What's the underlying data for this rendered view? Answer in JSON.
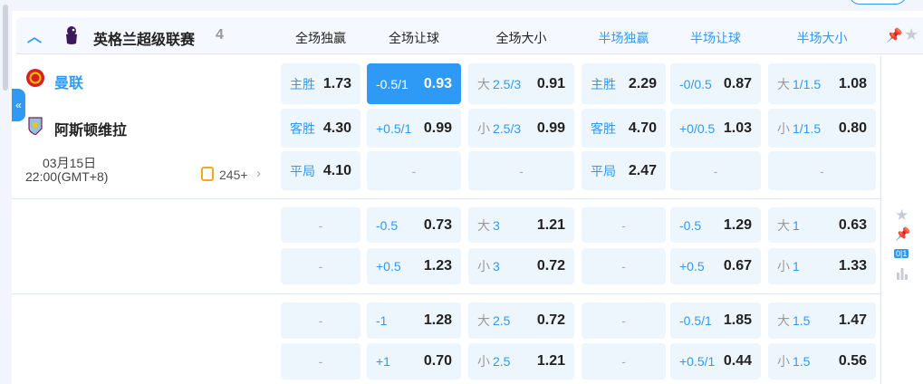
{
  "league": {
    "name": "英格兰超级联赛",
    "count": "4"
  },
  "columns": [
    {
      "label": "全场独赢",
      "half": false
    },
    {
      "label": "全场让球",
      "half": false
    },
    {
      "label": "全场大小",
      "half": false
    },
    {
      "label": "半场独赢",
      "half": true
    },
    {
      "label": "半场让球",
      "half": true
    },
    {
      "label": "半场大小",
      "half": true
    }
  ],
  "match": {
    "home": "曼联",
    "away": "阿斯顿维拉",
    "date": "03月15日",
    "time": "22:00(GMT+8)",
    "more_bets": "245+"
  },
  "colors": {
    "accent": "#2e9af5",
    "cell_bg": "#eef6fd"
  },
  "rows": [
    [
      {
        "pre": "主胜",
        "pb": true,
        "odds": "1.73"
      },
      {
        "line": "-0.5/1",
        "odds": "0.93",
        "active": true
      },
      {
        "pre": "大",
        "line": "2.5/3",
        "odds": "0.91"
      },
      {
        "pre": "主胜",
        "pb": true,
        "odds": "2.29"
      },
      {
        "line": "-0/0.5",
        "odds": "0.87"
      },
      {
        "pre": "大",
        "line": "1/1.5",
        "odds": "1.08"
      }
    ],
    [
      {
        "pre": "客胜",
        "pb": true,
        "odds": "4.30"
      },
      {
        "line": "+0.5/1",
        "odds": "0.99"
      },
      {
        "pre": "小",
        "line": "2.5/3",
        "odds": "0.99"
      },
      {
        "pre": "客胜",
        "pb": true,
        "odds": "4.70"
      },
      {
        "line": "+0/0.5",
        "odds": "1.03"
      },
      {
        "pre": "小",
        "line": "1/1.5",
        "odds": "0.80"
      }
    ],
    [
      {
        "pre": "平局",
        "pb": true,
        "odds": "4.10"
      },
      {
        "dash": "-"
      },
      {
        "dash": "-"
      },
      {
        "pre": "平局",
        "pb": true,
        "odds": "2.47"
      },
      {
        "dash": "-"
      },
      {
        "dash": "-"
      }
    ],
    [
      {
        "dash": "-"
      },
      {
        "line": "-0.5",
        "odds": "0.73"
      },
      {
        "pre": "大",
        "line": "3",
        "odds": "1.21"
      },
      {
        "dash": "-"
      },
      {
        "line": "-0.5",
        "odds": "1.29"
      },
      {
        "pre": "大",
        "line": "1",
        "odds": "0.63"
      }
    ],
    [
      {
        "dash": "-"
      },
      {
        "line": "+0.5",
        "odds": "1.23"
      },
      {
        "pre": "小",
        "line": "3",
        "odds": "0.72"
      },
      {
        "dash": "-"
      },
      {
        "line": "+0.5",
        "odds": "0.67"
      },
      {
        "pre": "小",
        "line": "1",
        "odds": "1.33"
      }
    ],
    [
      {
        "dash": "-"
      },
      {
        "line": "-1",
        "odds": "1.28"
      },
      {
        "pre": "大",
        "line": "2.5",
        "odds": "0.72"
      },
      {
        "dash": "-"
      },
      {
        "line": "-0.5/1",
        "odds": "1.85"
      },
      {
        "pre": "大",
        "line": "1.5",
        "odds": "1.47"
      }
    ],
    [
      {
        "dash": "-"
      },
      {
        "line": "+1",
        "odds": "0.70"
      },
      {
        "pre": "小",
        "line": "2.5",
        "odds": "1.21"
      },
      {
        "dash": "-"
      },
      {
        "line": "+0.5/1",
        "odds": "0.44"
      },
      {
        "pre": "小",
        "line": "1.5",
        "odds": "0.56"
      }
    ]
  ],
  "side_icons": [
    "star-icon",
    "pin-icon",
    "score-icon",
    "stats-icon"
  ],
  "score_badge": "0|1"
}
